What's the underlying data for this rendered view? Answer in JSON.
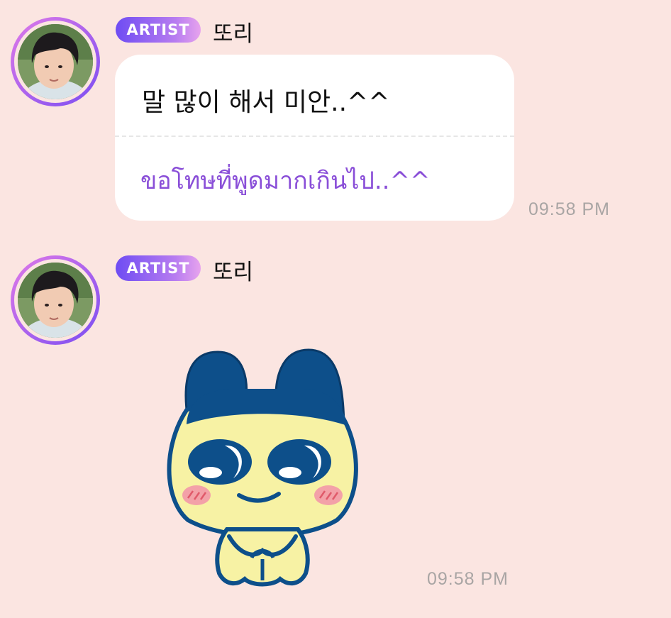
{
  "messages": [
    {
      "badge": "ARTIST",
      "name": "또리",
      "text_korean": "말 많이 해서 미안..^^",
      "text_translation": "ขอโทษที่พูดมากเกินไป..^^",
      "time": "09:58 PM"
    },
    {
      "badge": "ARTIST",
      "name": "또리",
      "sticker": "mametchi-sticker",
      "time": "09:58 PM"
    }
  ],
  "colors": {
    "background": "#fbe5e1",
    "translation_text": "#8a4fd8",
    "badge_gradient_start": "#6e4cf3",
    "badge_gradient_end": "#e7a3ee",
    "timestamp": "#a9a5a4"
  }
}
